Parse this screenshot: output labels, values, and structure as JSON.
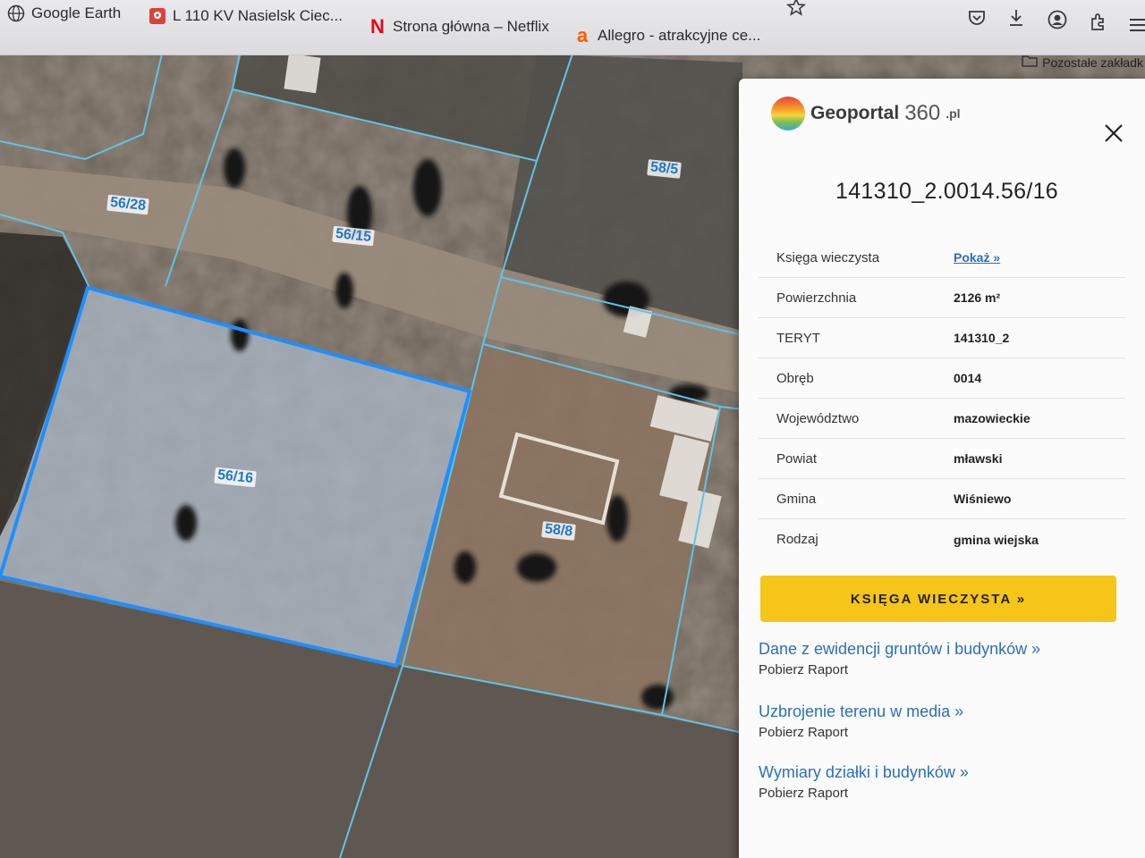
{
  "browser": {
    "bookmarks": [
      {
        "label": "Google Earth",
        "icon": "globe-icon"
      },
      {
        "label": "L 110 KV Nasielsk Ciec...",
        "icon": "map-pin-icon"
      },
      {
        "label": "Strona główna – Netflix",
        "icon": "netflix-icon"
      },
      {
        "label": "Allegro - atrakcyjne ce...",
        "icon": "allegro-icon"
      }
    ],
    "other_bookmarks": "Pozostałe zakładk",
    "toolbar_icons": [
      "star-icon",
      "pocket-icon",
      "download-icon",
      "account-icon",
      "extensions-icon",
      "menu-icon"
    ]
  },
  "map": {
    "parcel_labels": [
      "56/28",
      "56/15",
      "58/5",
      "56/16",
      "58/8"
    ],
    "colors": {
      "boundary": "#5fc3e8",
      "selected": "#1e8fff"
    }
  },
  "panel": {
    "logo": {
      "name": "Geoportal",
      "num": "360",
      "suffix": ".pl"
    },
    "parcel_id": "141310_2.0014.56/16",
    "rows": [
      {
        "key": "Księga wieczysta",
        "value": "Pokaż »",
        "link": true
      },
      {
        "key": "Powierzchnia",
        "value": "2126 m²"
      },
      {
        "key": "TERYT",
        "value": "141310_2"
      },
      {
        "key": "Obręb",
        "value": "0014"
      },
      {
        "key": "Województwo",
        "value": "mazowieckie"
      },
      {
        "key": "Powiat",
        "value": "mławski"
      },
      {
        "key": "Gmina",
        "value": "Wiśniewo"
      },
      {
        "key": "Rodzaj",
        "value": "gmina wiejska"
      }
    ],
    "kw_button": "KSIĘGA WIECZYSTA »",
    "links": [
      {
        "title": "Dane z ewidencji gruntów i budynków »",
        "sub": "Pobierz Raport"
      },
      {
        "title": "Uzbrojenie terenu w media »",
        "sub": "Pobierz Raport"
      },
      {
        "title": "Wymiary działki i budynków »",
        "sub": "Pobierz Raport"
      }
    ]
  }
}
